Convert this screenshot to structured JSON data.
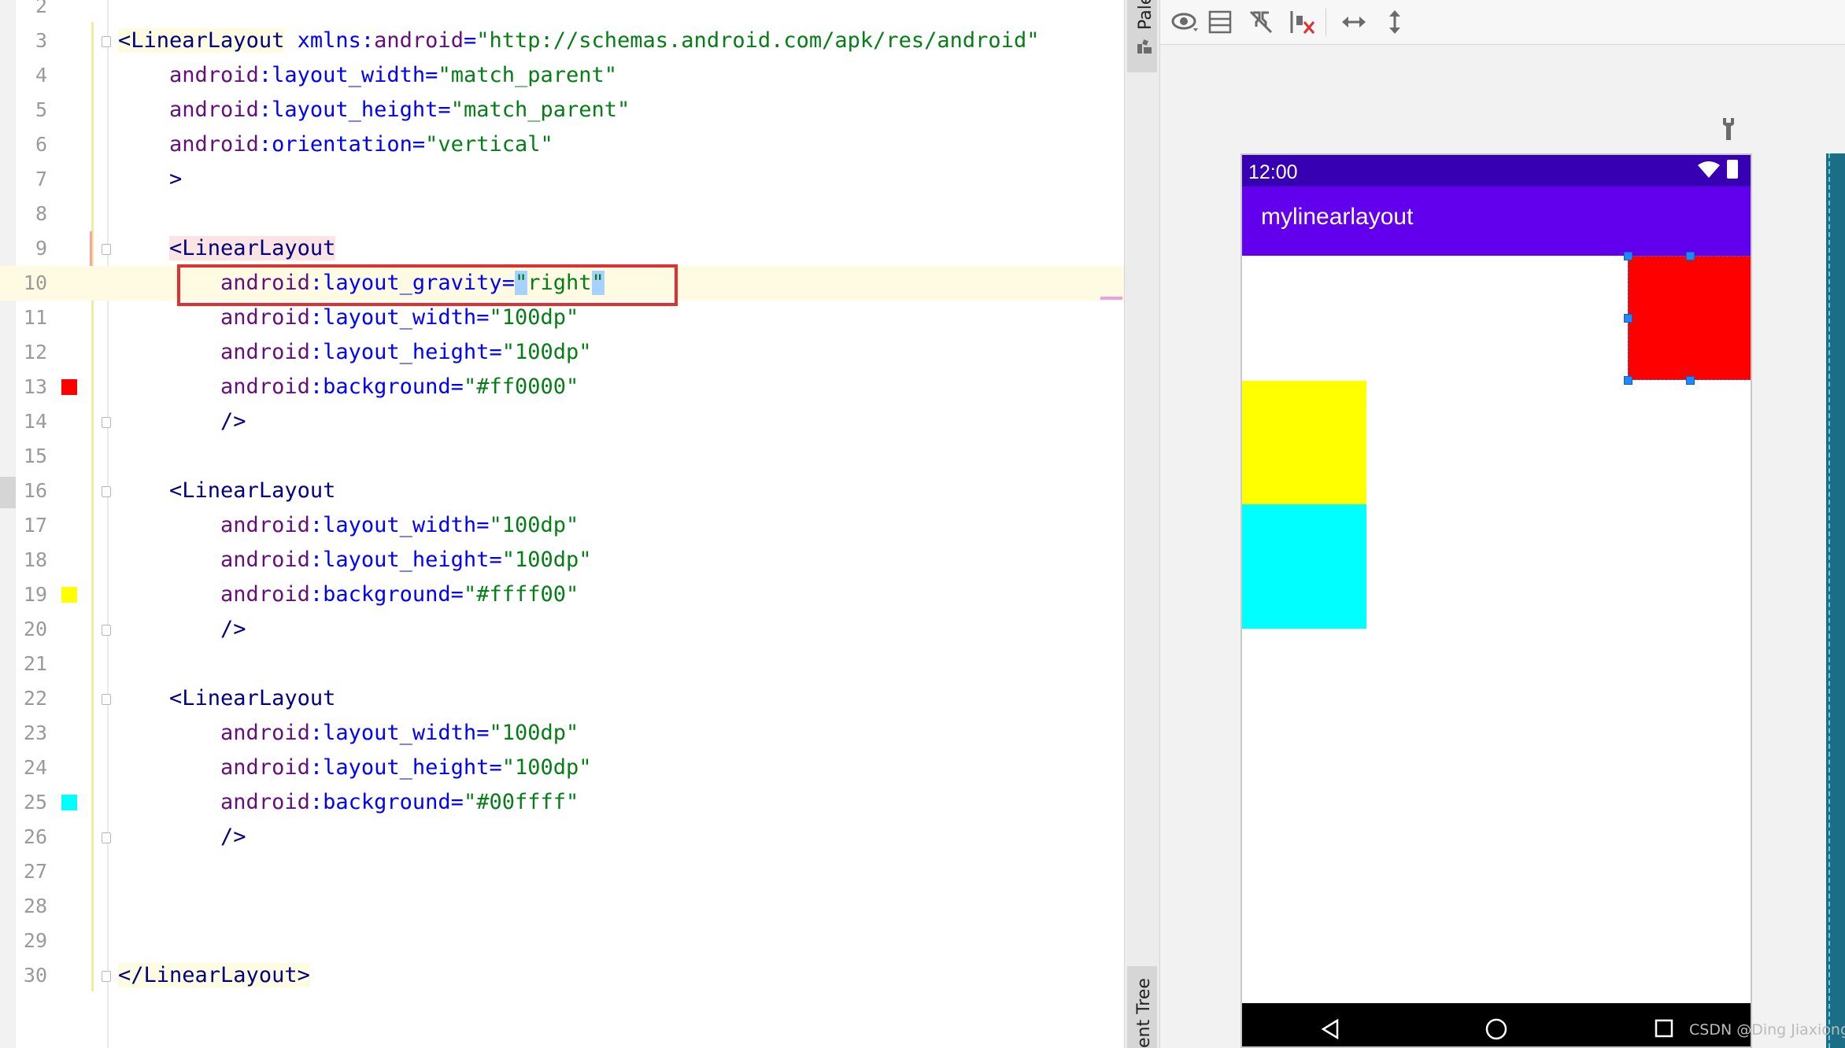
{
  "editor": {
    "lines": [
      {
        "num": "2",
        "segs": []
      },
      {
        "num": "3",
        "segs": [
          {
            "t": "<",
            "c": "tag tagbg"
          },
          {
            "t": "LinearLayout",
            "c": "tag tagbg"
          },
          {
            "t": " ",
            "c": ""
          },
          {
            "t": "xmlns:",
            "c": "attr"
          },
          {
            "t": "android",
            "c": "ns"
          },
          {
            "t": "=",
            "c": "attr"
          },
          {
            "t": "\"http://schemas.android.com/apk/res/android\"",
            "c": "val"
          }
        ]
      },
      {
        "num": "4",
        "segs": [
          {
            "t": "    ",
            "c": ""
          },
          {
            "t": "android",
            "c": "ns"
          },
          {
            "t": ":",
            "c": "attr"
          },
          {
            "t": "layout_width",
            "c": "attr"
          },
          {
            "t": "=",
            "c": "attr"
          },
          {
            "t": "\"match_parent\"",
            "c": "val"
          }
        ]
      },
      {
        "num": "5",
        "segs": [
          {
            "t": "    ",
            "c": ""
          },
          {
            "t": "android",
            "c": "ns"
          },
          {
            "t": ":",
            "c": "attr"
          },
          {
            "t": "layout_height",
            "c": "attr"
          },
          {
            "t": "=",
            "c": "attr"
          },
          {
            "t": "\"match_parent\"",
            "c": "val"
          }
        ]
      },
      {
        "num": "6",
        "segs": [
          {
            "t": "    ",
            "c": ""
          },
          {
            "t": "android",
            "c": "ns"
          },
          {
            "t": ":",
            "c": "attr"
          },
          {
            "t": "orientation",
            "c": "attr"
          },
          {
            "t": "=",
            "c": "attr"
          },
          {
            "t": "\"vertical\"",
            "c": "val"
          }
        ]
      },
      {
        "num": "7",
        "segs": [
          {
            "t": "    >",
            "c": "tag"
          }
        ]
      },
      {
        "num": "8",
        "segs": []
      },
      {
        "num": "9",
        "segs": [
          {
            "t": "    ",
            "c": ""
          },
          {
            "t": "<LinearLayout",
            "c": "tag tagerr"
          }
        ]
      },
      {
        "num": "10",
        "segs": [
          {
            "t": "        ",
            "c": ""
          },
          {
            "t": "android",
            "c": "ns"
          },
          {
            "t": ":",
            "c": "attr"
          },
          {
            "t": "layout_gravity",
            "c": "attr"
          },
          {
            "t": "=",
            "c": "attr"
          },
          {
            "t": "\"",
            "c": "val hlq"
          },
          {
            "t": "right",
            "c": "val"
          },
          {
            "t": "\"",
            "c": "val hlq"
          }
        ]
      },
      {
        "num": "11",
        "segs": [
          {
            "t": "        ",
            "c": ""
          },
          {
            "t": "android",
            "c": "ns"
          },
          {
            "t": ":",
            "c": "attr"
          },
          {
            "t": "layout_width",
            "c": "attr"
          },
          {
            "t": "=",
            "c": "attr"
          },
          {
            "t": "\"100dp\"",
            "c": "val"
          }
        ]
      },
      {
        "num": "12",
        "segs": [
          {
            "t": "        ",
            "c": ""
          },
          {
            "t": "android",
            "c": "ns"
          },
          {
            "t": ":",
            "c": "attr"
          },
          {
            "t": "layout_height",
            "c": "attr"
          },
          {
            "t": "=",
            "c": "attr"
          },
          {
            "t": "\"100dp\"",
            "c": "val"
          }
        ]
      },
      {
        "num": "13",
        "segs": [
          {
            "t": "        ",
            "c": ""
          },
          {
            "t": "android",
            "c": "ns"
          },
          {
            "t": ":",
            "c": "attr"
          },
          {
            "t": "background",
            "c": "attr"
          },
          {
            "t": "=",
            "c": "attr"
          },
          {
            "t": "\"#ff0000\"",
            "c": "val"
          }
        ]
      },
      {
        "num": "14",
        "segs": [
          {
            "t": "        />",
            "c": "tag"
          }
        ]
      },
      {
        "num": "15",
        "segs": []
      },
      {
        "num": "16",
        "segs": [
          {
            "t": "    ",
            "c": ""
          },
          {
            "t": "<LinearLayout",
            "c": "tag"
          }
        ]
      },
      {
        "num": "17",
        "segs": [
          {
            "t": "        ",
            "c": ""
          },
          {
            "t": "android",
            "c": "ns"
          },
          {
            "t": ":",
            "c": "attr"
          },
          {
            "t": "layout_width",
            "c": "attr"
          },
          {
            "t": "=",
            "c": "attr"
          },
          {
            "t": "\"100dp\"",
            "c": "val"
          }
        ]
      },
      {
        "num": "18",
        "segs": [
          {
            "t": "        ",
            "c": ""
          },
          {
            "t": "android",
            "c": "ns"
          },
          {
            "t": ":",
            "c": "attr"
          },
          {
            "t": "layout_height",
            "c": "attr"
          },
          {
            "t": "=",
            "c": "attr"
          },
          {
            "t": "\"100dp\"",
            "c": "val"
          }
        ]
      },
      {
        "num": "19",
        "segs": [
          {
            "t": "        ",
            "c": ""
          },
          {
            "t": "android",
            "c": "ns"
          },
          {
            "t": ":",
            "c": "attr"
          },
          {
            "t": "background",
            "c": "attr"
          },
          {
            "t": "=",
            "c": "attr"
          },
          {
            "t": "\"#ffff00\"",
            "c": "val"
          }
        ]
      },
      {
        "num": "20",
        "segs": [
          {
            "t": "        />",
            "c": "tag"
          }
        ]
      },
      {
        "num": "21",
        "segs": []
      },
      {
        "num": "22",
        "segs": [
          {
            "t": "    ",
            "c": ""
          },
          {
            "t": "<LinearLayout",
            "c": "tag"
          }
        ]
      },
      {
        "num": "23",
        "segs": [
          {
            "t": "        ",
            "c": ""
          },
          {
            "t": "android",
            "c": "ns"
          },
          {
            "t": ":",
            "c": "attr"
          },
          {
            "t": "layout_width",
            "c": "attr"
          },
          {
            "t": "=",
            "c": "attr"
          },
          {
            "t": "\"100dp\"",
            "c": "val"
          }
        ]
      },
      {
        "num": "24",
        "segs": [
          {
            "t": "        ",
            "c": ""
          },
          {
            "t": "android",
            "c": "ns"
          },
          {
            "t": ":",
            "c": "attr"
          },
          {
            "t": "layout_height",
            "c": "attr"
          },
          {
            "t": "=",
            "c": "attr"
          },
          {
            "t": "\"100dp\"",
            "c": "val"
          }
        ]
      },
      {
        "num": "25",
        "segs": [
          {
            "t": "        ",
            "c": ""
          },
          {
            "t": "android",
            "c": "ns"
          },
          {
            "t": ":",
            "c": "attr"
          },
          {
            "t": "background",
            "c": "attr"
          },
          {
            "t": "=",
            "c": "attr"
          },
          {
            "t": "\"#00ffff\"",
            "c": "val"
          }
        ]
      },
      {
        "num": "26",
        "segs": [
          {
            "t": "        />",
            "c": "tag"
          }
        ]
      },
      {
        "num": "27",
        "segs": []
      },
      {
        "num": "28",
        "segs": []
      },
      {
        "num": "29",
        "segs": []
      },
      {
        "num": "30",
        "segs": [
          {
            "t": "</",
            "c": "tag tagbg"
          },
          {
            "t": "LinearLayout",
            "c": "tag tagbg"
          },
          {
            "t": ">",
            "c": "tag tagbg"
          }
        ]
      }
    ],
    "current_line": "10",
    "swatches": {
      "13": "#ff0000",
      "19": "#ffff00",
      "25": "#00ffff"
    },
    "fold_lines": [
      "3",
      "9",
      "14",
      "16",
      "20",
      "22",
      "26",
      "30"
    ]
  },
  "side_tabs": {
    "palette": "Pale",
    "component_tree": "ent Tree"
  },
  "toolbar": {
    "icons": [
      "eye-icon",
      "blueprint-icon",
      "magnet-off-icon",
      "clear-constraints-icon",
      "horizontal-expand-icon",
      "vertical-expand-icon"
    ]
  },
  "device": {
    "clock": "12:00",
    "app_title": "mylinearlayout",
    "status_bar_color": "#3700b3",
    "app_bar_color": "#6200ee",
    "blocks": [
      {
        "name": "red-block",
        "color": "#ff0000",
        "gravity": "right"
      },
      {
        "name": "yellow-block",
        "color": "#ffff00"
      },
      {
        "name": "cyan-block",
        "color": "#00ffff"
      }
    ]
  },
  "watermark": "CSDN @Ding Jiaxiong"
}
